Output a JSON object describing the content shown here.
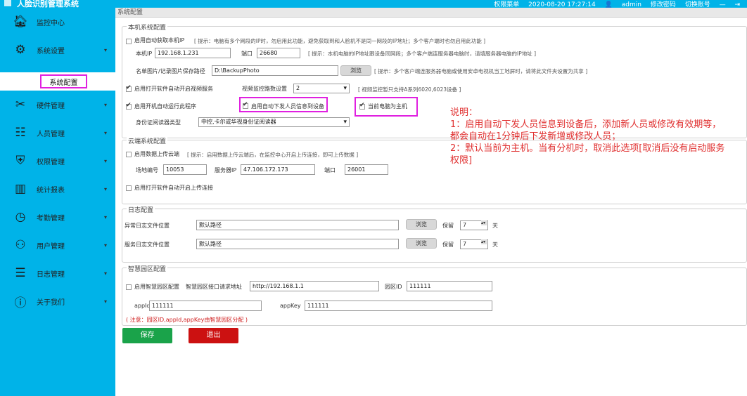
{
  "app": {
    "title": "人脸识别管理系统",
    "menu": "权限菜单",
    "datetime": "2020-08-20 17:27:14",
    "user": "admin",
    "change_pwd": "修改密码",
    "switch_account": "切换账号"
  },
  "sidebar": {
    "items": [
      {
        "label": "监控中心",
        "icon": "home-icon"
      },
      {
        "label": "系统设置",
        "icon": "gear-icon"
      },
      {
        "label": "硬件管理",
        "icon": "tools-icon"
      },
      {
        "label": "人员管理",
        "icon": "person-card-icon"
      },
      {
        "label": "权限管理",
        "icon": "shield-icon"
      },
      {
        "label": "统计报表",
        "icon": "chart-icon"
      },
      {
        "label": "考勤管理",
        "icon": "clock-icon"
      },
      {
        "label": "用户管理",
        "icon": "user-icon"
      },
      {
        "label": "日志管理",
        "icon": "log-icon"
      },
      {
        "label": "关于我们",
        "icon": "info-icon"
      }
    ],
    "sub_item": "系统配置"
  },
  "breadcrumb": "系统配置",
  "local": {
    "legend": "本机系统配置",
    "auto_ip_label": "启用自动获取本机IP",
    "auto_ip_hint": "[ 提示：电脑有多个网段的IP时，勿启用此功能，避免获取到和人脸机不是同一网段的IP地址；多个客户端时也勿启用此功能 ]",
    "ip_label": "本机IP",
    "ip_value": "192.168.1.231",
    "port_label": "端口",
    "port_value": "26680",
    "ip_hint": "[ 提示：本机电脑的IP地址跟设备同网段；多个客户端连服务器电脑时，请填服务器电脑的IP地址 ]",
    "path_label": "名单图片/记录图片保存路径",
    "path_value": "D:\\BackupPhoto",
    "browse": "浏览",
    "path_hint": "[ 提示：多个客户端连服务器电脑或使用安卓电视机当工地屏时，请将此文件夹设置为共享 ]",
    "video_service_label": "启用打开软件自动开启视频服务",
    "video_channels_label": "视频监控路数设置",
    "video_channels_value": "2",
    "video_hint": "[ 视频监控暂只支持A系列6020,6023设备 ]",
    "autorun_label": "启用开机自动运行此程序",
    "auto_push_label": "启用自动下发人员信息到设备",
    "host_label": "当前电脑为主机",
    "idreader_label": "身份证阅读器类型",
    "idreader_value": "中控,卡尔或华视身份证阅读器"
  },
  "cloud": {
    "legend": "云端系统配置",
    "upload_label": "启用数据上传云端",
    "upload_hint": "[ 提示：启用数据上传云端后，在监控中心开启上传连接，即可上传数据 ]",
    "site_label": "场地编号",
    "site_value": "10053",
    "server_ip_label": "服务器IP",
    "server_ip_value": "47.106.172.173",
    "port_label": "端口",
    "port_value": "26001",
    "auto_upload_label": "启用打开软件自动开启上传连接"
  },
  "log": {
    "legend": "日志配置",
    "error_label": "异常日志文件位置",
    "error_value": "默认路径",
    "service_label": "服务日志文件位置",
    "service_value": "默认路径",
    "browse": "浏览",
    "keep_label": "保留",
    "keep_value": "7",
    "unit": "天"
  },
  "park": {
    "legend": "智慧园区配置",
    "enable_label": "启用智慧园区配置",
    "url_label": "智慧园区接口请求地址",
    "url_value": "http://192.168.1.1",
    "park_id_label": "园区ID",
    "park_id_value": "111111",
    "appid_label": "appId",
    "appid_value": "111111",
    "appkey_label": "appKey",
    "appkey_value": "111111",
    "note": "( 注意：园区ID,appId,appKey由智慧园区分配 )"
  },
  "buttons": {
    "save": "保存",
    "exit": "退出"
  },
  "annotation": {
    "title": "说明：",
    "line1": "1：启用自动下发人员信息到设备后，添加新人员或修改有效期等，",
    "line2": "都会自动在1分钟后下发新增或修改人员；",
    "line3": "2：默认当前为主机。当有分机时，取消此选项[取消后没有启动服务",
    "line4": "权限]"
  },
  "colors": {
    "sidebar": "#00b3e8",
    "save": "#1aa34a",
    "exit": "#cc1111",
    "highlight": "#e020e0",
    "note": "#e03030"
  }
}
